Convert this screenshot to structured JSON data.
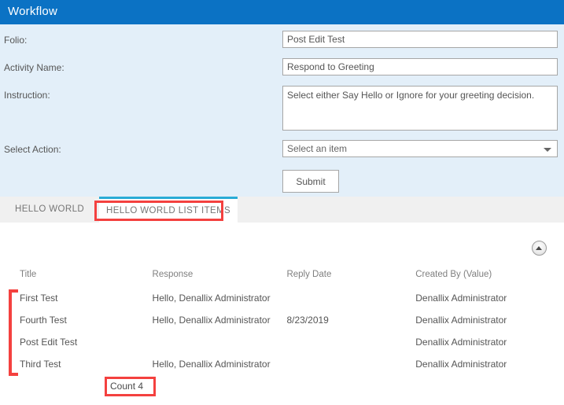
{
  "window": {
    "title": "Workflow",
    "header_color": "#0b72c4",
    "form_bg_color": "#e3eff9",
    "tab_accent_color": "#29abd6",
    "annotation_color": "#f4413f"
  },
  "form": {
    "fields": [
      {
        "label": "Folio:",
        "value": "Post Edit Test",
        "placeholder": ""
      },
      {
        "label": "Activity Name:",
        "value": "Respond to Greeting",
        "placeholder": ""
      },
      {
        "label": "Instruction:",
        "value": "Select either Say Hello or Ignore for your greeting decision.",
        "placeholder": ""
      },
      {
        "label": "Select Action:",
        "value": "Select an item",
        "placeholder": "Select an item"
      }
    ],
    "select_icon": "chevron-down-icon",
    "submit_label": "Submit"
  },
  "tabs": [
    {
      "label": "HELLO WORLD",
      "selected": false
    },
    {
      "label": "HELLO WORLD LIST ITEMS",
      "selected": true
    }
  ],
  "content": {
    "collapse_icon": "chevron-up-icon",
    "table": {
      "columns": [
        "Title",
        "Response",
        "Reply Date",
        "Created By (Value)"
      ],
      "rows": [
        {
          "title": "First Test",
          "response": "Hello, Denallix Administrator",
          "reply_date": "",
          "created_by": "Denallix Administrator"
        },
        {
          "title": "Fourth Test",
          "response": "Hello, Denallix Administrator",
          "reply_date": "8/23/2019",
          "created_by": "Denallix Administrator"
        },
        {
          "title": "Post Edit Test",
          "response": "",
          "reply_date": "",
          "created_by": "Denallix Administrator"
        },
        {
          "title": "Third Test",
          "response": "Hello, Denallix Administrator",
          "reply_date": "",
          "created_by": "Denallix Administrator"
        }
      ]
    },
    "count_label": "Count 4"
  }
}
